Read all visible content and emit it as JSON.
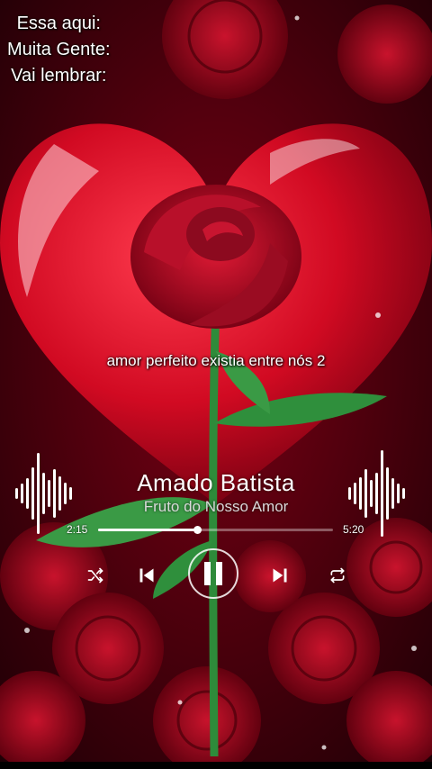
{
  "overlay": {
    "lines": [
      "Essa aqui:",
      "Muita Gente:",
      "Vai lembrar:"
    ]
  },
  "lyric": "amor perfeito existia entre nós 2",
  "track": {
    "title": "Amado Batista",
    "subtitle": "Fruto do Nosso Amor"
  },
  "playback": {
    "current_time": "2:15",
    "total_time": "5:20",
    "progress": 0.42
  },
  "controls": {
    "shuffle_icon": "shuffle-icon",
    "previous_icon": "skip-previous-icon",
    "pause_icon": "pause-icon",
    "next_icon": "skip-next-icon",
    "repeat_icon": "repeat-icon"
  },
  "colors": {
    "accent": "#ffffff",
    "background": "#8b0016",
    "rose": "#c0102a"
  }
}
